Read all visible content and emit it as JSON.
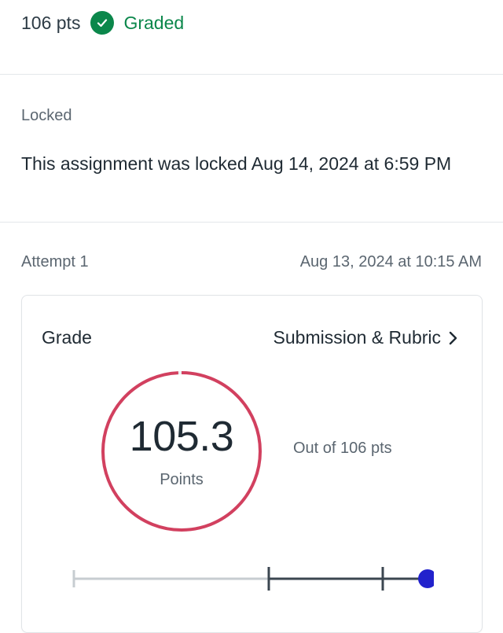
{
  "header": {
    "points": "106 pts",
    "status": "Graded",
    "status_color": "#0b874b",
    "status_icon": "check-circle-icon"
  },
  "lock": {
    "label": "Locked",
    "message": "This assignment was locked Aug 14, 2024 at 6:59 PM"
  },
  "attempt": {
    "label": "Attempt 1",
    "date": "Aug 13, 2024 at 10:15 AM"
  },
  "grade_card": {
    "title": "Grade",
    "link_label": "Submission & Rubric",
    "link_icon": "chevron-right-icon",
    "score": "105.3",
    "score_unit": "Points",
    "out_of": "Out of 106 pts",
    "score_fraction": 0.993,
    "ring_color": "#d2405f",
    "slider_accent": "#2222cc"
  }
}
